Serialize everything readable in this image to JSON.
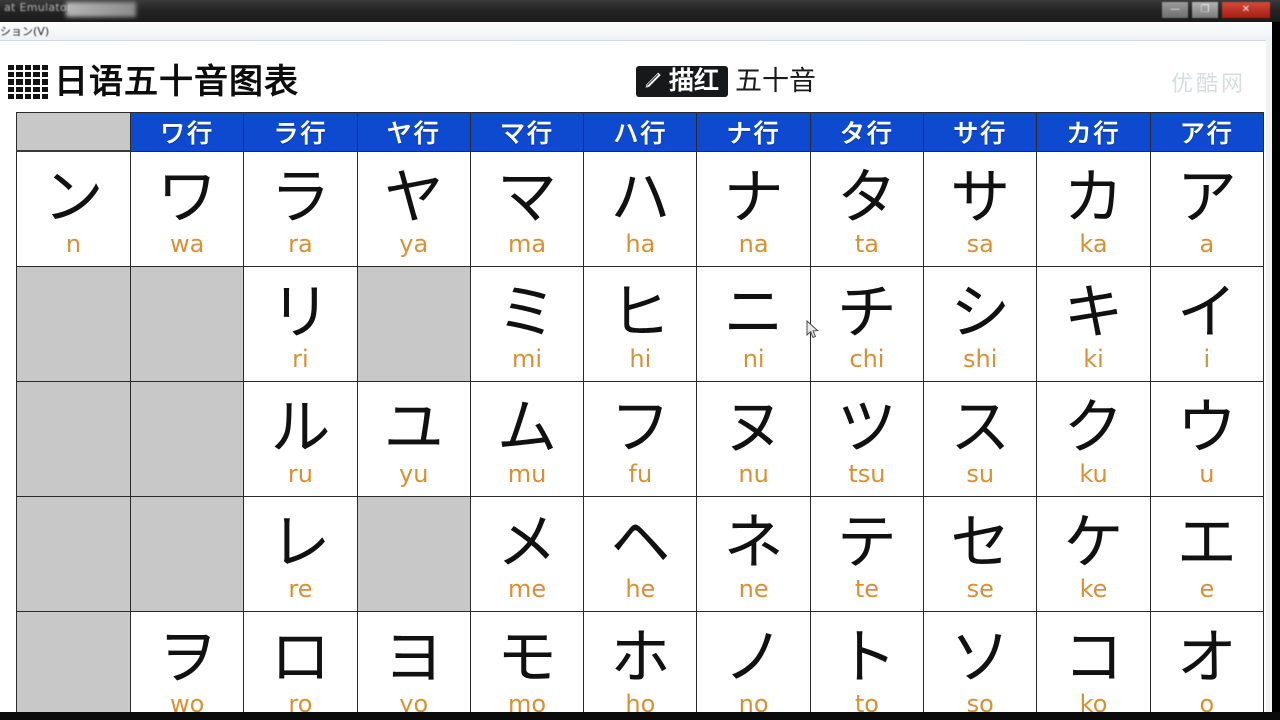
{
  "os_chrome": {
    "window_title": "at Emulator",
    "buttons": [
      {
        "name": "minimize",
        "glyph": "—"
      },
      {
        "name": "maximize",
        "glyph": "❐"
      },
      {
        "name": "close",
        "glyph": "✕"
      }
    ]
  },
  "menubar": {
    "visible_item": "ション(V)"
  },
  "header": {
    "title": "日语五十音图表",
    "grid_icon": "grid-dots-icon",
    "badge_icon": "pencil-icon",
    "badge_label": "描红",
    "suffix": "五十音",
    "watermark": "优酷网"
  },
  "colors": {
    "header_blue": "#0d4ad0",
    "empty_gray": "#c8c8c8",
    "romaji_orange": "#d79134",
    "kana_black": "#111111",
    "badge_dark": "#17181a"
  },
  "table": {
    "corner_header": "",
    "column_headers": [
      "ワ行",
      "ラ行",
      "ヤ行",
      "マ行",
      "ハ行",
      "ナ行",
      "タ行",
      "サ行",
      "カ行",
      "ア行"
    ],
    "rows": [
      {
        "row_label": "ン",
        "row_romaji": "n",
        "cells": [
          {
            "kana": "ワ",
            "romaji": "wa",
            "empty": false
          },
          {
            "kana": "ラ",
            "romaji": "ra",
            "empty": false
          },
          {
            "kana": "ヤ",
            "romaji": "ya",
            "empty": false
          },
          {
            "kana": "マ",
            "romaji": "ma",
            "empty": false
          },
          {
            "kana": "ハ",
            "romaji": "ha",
            "empty": false
          },
          {
            "kana": "ナ",
            "romaji": "na",
            "empty": false
          },
          {
            "kana": "タ",
            "romaji": "ta",
            "empty": false
          },
          {
            "kana": "サ",
            "romaji": "sa",
            "empty": false
          },
          {
            "kana": "カ",
            "romaji": "ka",
            "empty": false
          },
          {
            "kana": "ア",
            "romaji": "a",
            "empty": false
          }
        ]
      },
      {
        "row_label": "",
        "row_romaji": "",
        "first_empty": true,
        "cells": [
          {
            "kana": "",
            "romaji": "",
            "empty": true
          },
          {
            "kana": "リ",
            "romaji": "ri",
            "empty": false
          },
          {
            "kana": "",
            "romaji": "",
            "empty": true
          },
          {
            "kana": "ミ",
            "romaji": "mi",
            "empty": false
          },
          {
            "kana": "ヒ",
            "romaji": "hi",
            "empty": false
          },
          {
            "kana": "ニ",
            "romaji": "ni",
            "empty": false
          },
          {
            "kana": "チ",
            "romaji": "chi",
            "empty": false
          },
          {
            "kana": "シ",
            "romaji": "shi",
            "empty": false
          },
          {
            "kana": "キ",
            "romaji": "ki",
            "empty": false
          },
          {
            "kana": "イ",
            "romaji": "i",
            "empty": false
          }
        ]
      },
      {
        "row_label": "",
        "row_romaji": "",
        "first_empty": true,
        "cells": [
          {
            "kana": "",
            "romaji": "",
            "empty": true
          },
          {
            "kana": "ル",
            "romaji": "ru",
            "empty": false
          },
          {
            "kana": "ユ",
            "romaji": "yu",
            "empty": false
          },
          {
            "kana": "ム",
            "romaji": "mu",
            "empty": false
          },
          {
            "kana": "フ",
            "romaji": "fu",
            "empty": false
          },
          {
            "kana": "ヌ",
            "romaji": "nu",
            "empty": false
          },
          {
            "kana": "ツ",
            "romaji": "tsu",
            "empty": false
          },
          {
            "kana": "ス",
            "romaji": "su",
            "empty": false
          },
          {
            "kana": "ク",
            "romaji": "ku",
            "empty": false
          },
          {
            "kana": "ウ",
            "romaji": "u",
            "empty": false
          }
        ]
      },
      {
        "row_label": "",
        "row_romaji": "",
        "first_empty": true,
        "cells": [
          {
            "kana": "",
            "romaji": "",
            "empty": true
          },
          {
            "kana": "レ",
            "romaji": "re",
            "empty": false
          },
          {
            "kana": "",
            "romaji": "",
            "empty": true
          },
          {
            "kana": "メ",
            "romaji": "me",
            "empty": false
          },
          {
            "kana": "ヘ",
            "romaji": "he",
            "empty": false
          },
          {
            "kana": "ネ",
            "romaji": "ne",
            "empty": false
          },
          {
            "kana": "テ",
            "romaji": "te",
            "empty": false
          },
          {
            "kana": "セ",
            "romaji": "se",
            "empty": false
          },
          {
            "kana": "ケ",
            "romaji": "ke",
            "empty": false
          },
          {
            "kana": "エ",
            "romaji": "e",
            "empty": false
          }
        ]
      },
      {
        "row_label": "",
        "row_romaji": "",
        "first_empty": true,
        "cells": [
          {
            "kana": "ヲ",
            "romaji": "wo",
            "empty": false
          },
          {
            "kana": "ロ",
            "romaji": "ro",
            "empty": false
          },
          {
            "kana": "ヨ",
            "romaji": "yo",
            "empty": false
          },
          {
            "kana": "モ",
            "romaji": "mo",
            "empty": false
          },
          {
            "kana": "ホ",
            "romaji": "ho",
            "empty": false
          },
          {
            "kana": "ノ",
            "romaji": "no",
            "empty": false
          },
          {
            "kana": "ト",
            "romaji": "to",
            "empty": false
          },
          {
            "kana": "ソ",
            "romaji": "so",
            "empty": false
          },
          {
            "kana": "コ",
            "romaji": "ko",
            "empty": false
          },
          {
            "kana": "オ",
            "romaji": "o",
            "empty": false
          }
        ]
      }
    ]
  }
}
